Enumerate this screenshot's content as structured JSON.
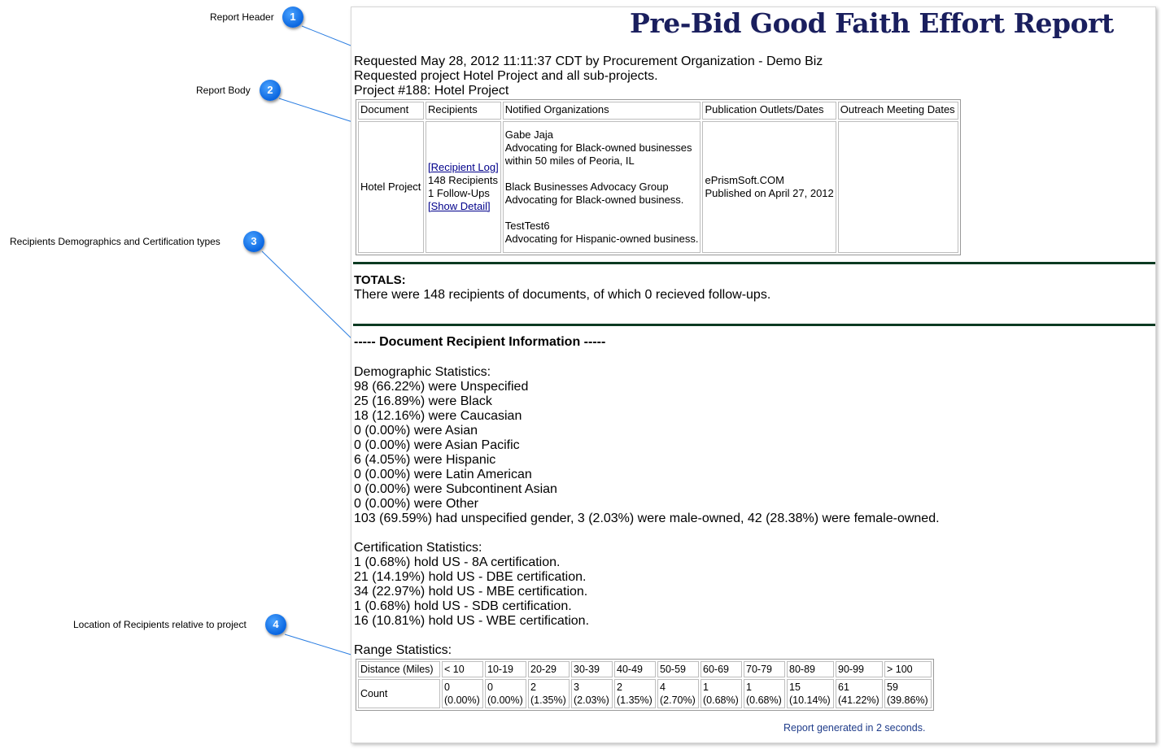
{
  "callouts": [
    {
      "number": "1",
      "label": "Report Header"
    },
    {
      "number": "2",
      "label": "Report Body"
    },
    {
      "number": "3",
      "label": "Recipients Demographics and Certification types"
    },
    {
      "number": "4",
      "label": "Location of Recipients relative to project"
    }
  ],
  "report": {
    "title": "Pre-Bid Good Faith Effort Report",
    "requested_line": "Requested May 28, 2012 11:11:37 CDT by Procurement Organization - Demo Biz",
    "project_scope_line": "Requested project Hotel Project and all sub-projects.",
    "project_line": "Project #188: Hotel Project",
    "table": {
      "headers": [
        "Document",
        "Recipients",
        "Notified Organizations",
        "Publication Outlets/Dates",
        "Outreach Meeting Dates"
      ],
      "document": "Hotel Project",
      "recipient_log_link": "[Recipient Log]",
      "recipients_count": "148 Recipients",
      "follow_ups": "1 Follow-Ups",
      "show_detail_link": "[Show Detail]",
      "org1_name": "Gabe Jaja",
      "org1_desc_a": "Advocating for Black-owned businesses",
      "org1_desc_b": "within 50 miles of Peoria, IL",
      "org2_name": "Black Businesses Advocacy Group",
      "org2_desc": "Advocating for Black-owned business.",
      "org3_name": "TestTest6",
      "org3_desc": "Advocating for Hispanic-owned business.",
      "publication_outlet": "ePrismSoft.COM",
      "publication_date": "Published on April 27, 2012",
      "outreach_dates": ""
    },
    "totals_heading": "TOTALS:",
    "totals_text": "There were 148 recipients of documents, of which 0 recieved follow-ups.",
    "section_heading": "----- Document Recipient Information -----",
    "demographic_heading": "Demographic Statistics:",
    "demographics": [
      "98 (66.22%) were Unspecified",
      "25 (16.89%) were Black",
      "18 (12.16%) were Caucasian",
      "0 (0.00%) were Asian",
      "0 (0.00%) were Asian Pacific",
      "6 (4.05%) were Hispanic",
      "0 (0.00%) were Latin American",
      "0 (0.00%) were Subcontinent Asian",
      "0 (0.00%) were Other",
      "103 (69.59%) had unspecified gender, 3 (2.03%) were male-owned, 42 (28.38%) were female-owned."
    ],
    "certification_heading": "Certification Statistics:",
    "certifications": [
      "1 (0.68%) hold US - 8A certification.",
      "21 (14.19%) hold US - DBE certification.",
      "34 (22.97%) hold US - MBE certification.",
      "1 (0.68%) hold US - SDB certification.",
      "16 (10.81%) hold US - WBE certification."
    ],
    "range_heading": "Range Statistics:",
    "range_table": {
      "row1_label": "Distance (Miles)",
      "row2_label": "Count",
      "ranges": [
        "< 10",
        "10-19",
        "20-29",
        "30-39",
        "40-49",
        "50-59",
        "60-69",
        "70-79",
        "80-89",
        "90-99",
        "> 100"
      ],
      "counts": [
        "0",
        "0",
        "2",
        "3",
        "2",
        "4",
        "1",
        "1",
        "15",
        "61",
        "59"
      ],
      "percents": [
        "(0.00%)",
        "(0.00%)",
        "(1.35%)",
        "(2.03%)",
        "(1.35%)",
        "(2.70%)",
        "(0.68%)",
        "(0.68%)",
        "(10.14%)",
        "(41.22%)",
        "(39.86%)"
      ]
    },
    "generated_text": "Report generated in 2 seconds."
  }
}
